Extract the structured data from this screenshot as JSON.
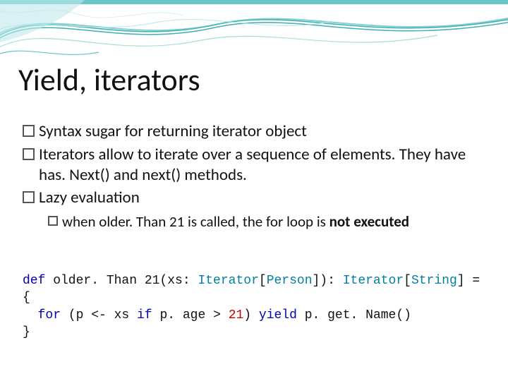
{
  "title": "Yield, iterators",
  "bullets": {
    "b1": "Syntax sugar for returning iterator object",
    "b2": "Iterators allow to iterate over a sequence of elements. They have has. Next() and next() methods.",
    "b3": "Lazy evaluation",
    "b3a_pre": "when older. Than 21 is called, the for loop is ",
    "b3a_strong": "not executed"
  },
  "code": {
    "kw_def": "def",
    "fn": " older. Than 21(xs: ",
    "typ_iter1": "Iterator",
    "lbracket1": "[",
    "typ_person": "Person",
    "rbracket1": "]): ",
    "typ_iter2": "Iterator",
    "lbracket2": "[",
    "typ_string": "String",
    "rbracket2": "] =",
    "brace_open": "{",
    "indent": "  ",
    "kw_for": "for",
    "for_head": " (p <- xs ",
    "kw_if": "if",
    "cond": " p. age > ",
    "num21": "21",
    "rparen": ") ",
    "kw_yield": "yield",
    "tail": " p. get. Name()",
    "brace_close": "}"
  }
}
